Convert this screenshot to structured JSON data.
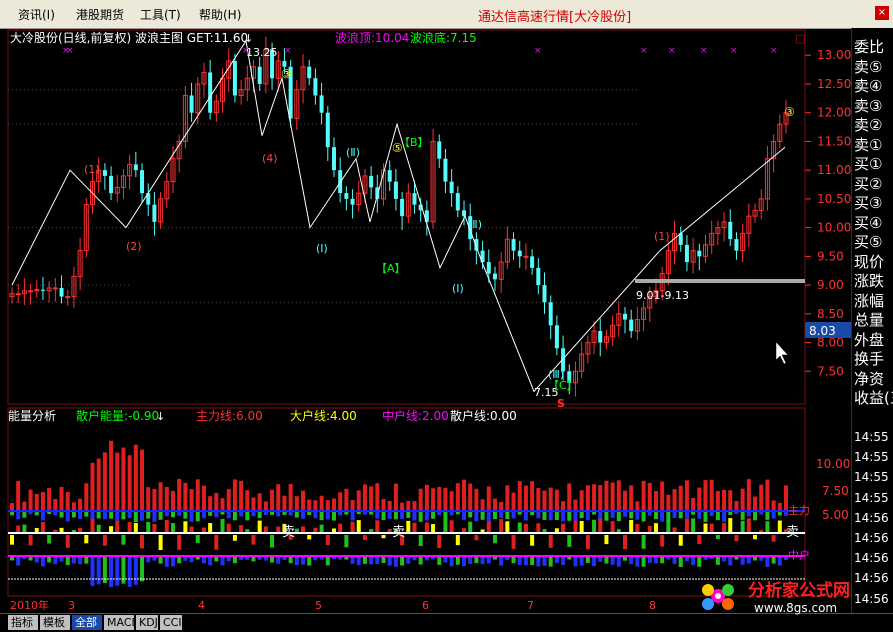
{
  "menu": {
    "items": [
      "资讯(I)",
      "港股期货",
      "工具(T)",
      "帮助(H)"
    ],
    "app_title": "通达信高速行情[大冷股份]"
  },
  "main_chart": {
    "header": "大冷股份(日线,前复权) 波浪主图 GET:11.60",
    "wave_top": "波浪顶:10.04",
    "wave_bottom": "波浪底:7.15",
    "price_ticks": [
      "13.00",
      "12.50",
      "12.00",
      "11.50",
      "11.00",
      "10.50",
      "10.00",
      "9.50",
      "9.00",
      "8.50",
      "8.00",
      "7.50"
    ],
    "current_price_tag": "8.03",
    "high_label": "13.25",
    "low_label": "7.15",
    "range_label": "9.01-9.13",
    "wave_labels": [
      "③",
      "(2)",
      "(4)",
      "(Ⅱ)",
      "⑤",
      "【B】",
      "(Ⅰ)",
      "【A】",
      "(Ⅱ)",
      "(Ⅰ)",
      "(Ⅲ)",
      "【C】",
      "③",
      "(1)",
      "(1)"
    ],
    "s_marker": "S"
  },
  "indicator": {
    "name": "能量分析",
    "retail_energy": "散户能量:-0.90",
    "main_line": "主力线:6.00",
    "large_line": "大户线:4.00",
    "mid_line": "中户线:2.00",
    "retail_line": "散户线:0.00",
    "ticks": [
      "10.00",
      "7.50",
      "5.00"
    ],
    "sell_labels": [
      "卖",
      "卖",
      "卖"
    ],
    "right_labels": [
      "主力",
      "中户"
    ]
  },
  "date_axis": [
    "2010年",
    "3",
    "4",
    "5",
    "6",
    "7",
    "8"
  ],
  "tabs": [
    "指标",
    "模板",
    "全部",
    "MACD",
    "KDJ",
    "CCI"
  ],
  "right_panel": {
    "rows": [
      "委比",
      "卖⑤",
      "卖④",
      "卖③",
      "卖②",
      "卖①",
      "买①",
      "买②",
      "买③",
      "买④",
      "买⑤",
      "现价",
      "涨跌",
      "涨幅",
      "总量",
      "外盘",
      "换手",
      "净资",
      "收益(三)"
    ],
    "times": [
      "14:55",
      "14:55",
      "14:55",
      "14:55",
      "14:56",
      "14:56",
      "14:56",
      "14:56",
      "14:56"
    ]
  },
  "logo": {
    "name": "分析家公式网",
    "url": "www.8gs.com"
  },
  "colors": {
    "up": "#ff3030",
    "down": "#54fcfc",
    "main_line": "#ff3030",
    "large_line": "#ffff00",
    "mid_line": "#ff00ff",
    "retail_line": "#ffffff",
    "title_red": "#d00000"
  },
  "chart_data": {
    "type": "candlestick",
    "title": "大冷股份(日线,前复权)",
    "ylim": [
      7.0,
      13.3
    ],
    "y_ticks": [
      7.5,
      8.0,
      8.5,
      9.0,
      9.5,
      10.0,
      10.5,
      11.0,
      11.5,
      12.0,
      12.5,
      13.0
    ],
    "wave_high": 13.25,
    "wave_low": 7.15,
    "current": 8.03,
    "series": [
      {
        "name": "close",
        "values": [
          8.85,
          8.85,
          8.9,
          8.9,
          8.92,
          8.9,
          8.95,
          8.95,
          8.8,
          8.8,
          9.15,
          9.6,
          10.4,
          10.8,
          11.0,
          10.9,
          10.6,
          10.7,
          10.9,
          11.1,
          11.0,
          10.6,
          10.4,
          10.1,
          10.5,
          10.8,
          11.2,
          11.5,
          12.3,
          12.0,
          12.5,
          12.7,
          12.0,
          12.2,
          12.6,
          12.9,
          12.3,
          12.4,
          12.6,
          12.8,
          12.5,
          13.1,
          12.6,
          12.9,
          12.8,
          11.9,
          12.4,
          12.8,
          12.6,
          12.3,
          12.0,
          11.4,
          11.0,
          10.6,
          10.5,
          10.4,
          10.6,
          10.9,
          10.7,
          10.5,
          11.0,
          10.8,
          10.5,
          10.2,
          10.6,
          10.4,
          10.3,
          10.1,
          11.5,
          11.2,
          10.8,
          10.6,
          10.3,
          10.2,
          9.8,
          9.6,
          9.4,
          9.2,
          9.1,
          9.4,
          9.8,
          9.6,
          9.5,
          9.5,
          9.3,
          9.0,
          8.7,
          8.3,
          7.9,
          7.5,
          7.3,
          7.5,
          7.8,
          8.0,
          8.2,
          8.0,
          8.1,
          8.3,
          8.5,
          8.4,
          8.2,
          8.4,
          8.6,
          8.8,
          8.9,
          9.2,
          9.6,
          9.9,
          9.7,
          9.4,
          9.6,
          9.5,
          9.7,
          9.9,
          10.0,
          10.1,
          9.8,
          9.6,
          9.9,
          10.2,
          10.3,
          10.5,
          11.2,
          11.5,
          11.8,
          12.0
        ]
      }
    ],
    "indicator": {
      "main_line": 6.0,
      "large_line": 4.0,
      "mid_line": 2.0,
      "retail_line": 0.0,
      "retail_energy": -0.9
    }
  }
}
